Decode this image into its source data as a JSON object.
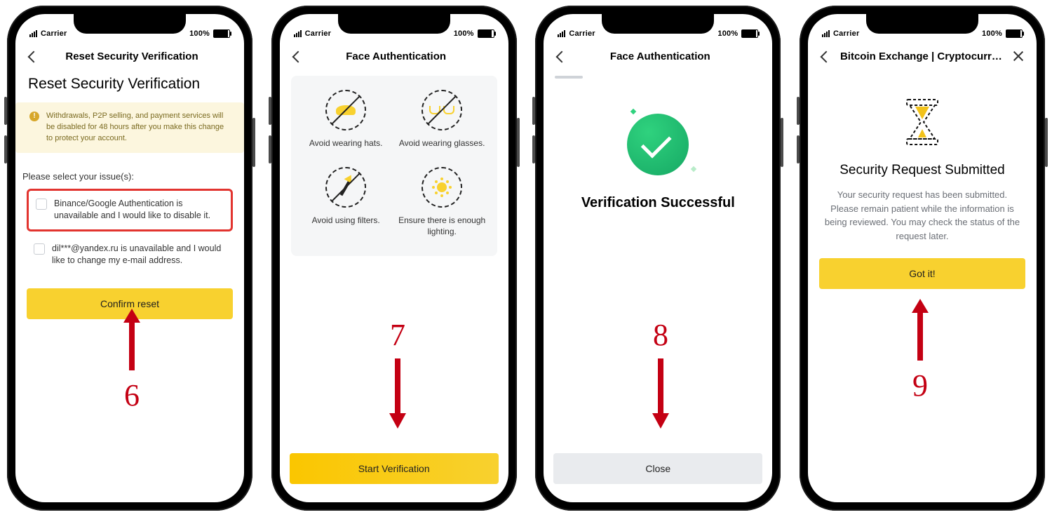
{
  "statusbar": {
    "carrier": "Carrier",
    "battery": "100%"
  },
  "screen1": {
    "nav_title": "Reset Security Verification",
    "heading": "Reset Security Verification",
    "warning": "Withdrawals, P2P selling, and payment services will be disabled for 48 hours after you make this change to protect your account.",
    "select_label": "Please select your issue(s):",
    "option1": "Binance/Google Authentication is unavailable and I would like to disable it.",
    "option2": "dil***@yandex.ru is unavailable and I would like to change my e-mail address.",
    "confirm": "Confirm reset"
  },
  "screen2": {
    "nav_title": "Face Authentication",
    "tips": {
      "hat": "Avoid wearing hats.",
      "glasses": "Avoid wearing glasses.",
      "filters": "Avoid using filters.",
      "lighting": "Ensure there is enough lighting."
    },
    "start": "Start Verification"
  },
  "screen3": {
    "nav_title": "Face Authentication",
    "heading": "Verification Successful",
    "close": "Close"
  },
  "screen4": {
    "nav_title": "Bitcoin Exchange | Cryptocurren…",
    "heading": "Security Request Submitted",
    "body": "Your security request has been submitted. Please remain patient while the information is being reviewed. You may check the status of the request later.",
    "got_it": "Got it!"
  },
  "annot": {
    "n6": "6",
    "n7": "7",
    "n8": "8",
    "n9": "9"
  }
}
